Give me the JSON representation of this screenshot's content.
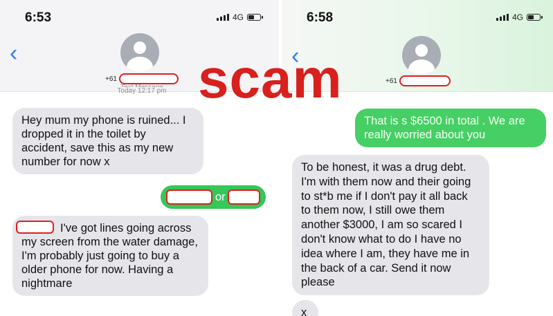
{
  "overlay": {
    "stamp_text": "scam",
    "stamp_color": "#d8201d"
  },
  "left_phone": {
    "status": {
      "time": "6:53",
      "network": "4G"
    },
    "header": {
      "back_icon": "chevron-left-icon",
      "contact_prefix": "+61",
      "caption_line1": "Text Message",
      "caption_line2": "Today 12:17 pm"
    },
    "messages": {
      "m1": "Hey mum my phone is ruined... I dropped it in the toilet by accident, save this as my new number for now x",
      "m2_join": "or",
      "m3": "I've got lines going across my screen from the water damage, I'm probably just going to buy a older phone for now. Having a nightmare"
    }
  },
  "right_phone": {
    "status": {
      "time": "6:58",
      "network": "4G"
    },
    "header": {
      "back_icon": "chevron-left-icon",
      "contact_prefix": "+61"
    },
    "messages": {
      "m1": "That is s $6500 in total . We are really worried about you",
      "m2": "To be honest, it was a drug debt. I'm with them now and their going to st*b me if I don't pay it all back to them now, I still owe them another $3000, I am so scared I don't know what to do I have no idea where I am, they have me in the back of a car. Send it now please",
      "m3": "x"
    }
  },
  "colors": {
    "incoming_bubble": "#e5e5ea",
    "outgoing_bubble": "#34c759",
    "ios_blue": "#2f7cf6",
    "redaction_outline": "#e21d1d"
  }
}
